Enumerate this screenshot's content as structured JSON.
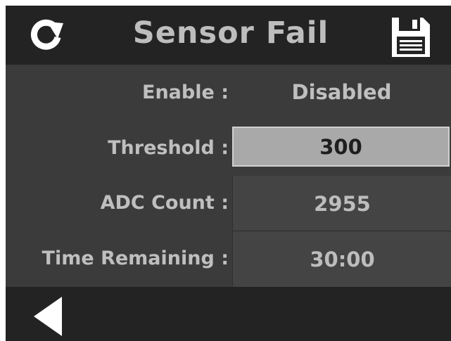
{
  "header": {
    "title": "Sensor Fail",
    "refresh_icon": "refresh-icon",
    "save_icon": "save-icon"
  },
  "rows": {
    "enable": {
      "label": "Enable :",
      "value": "Disabled"
    },
    "threshold": {
      "label": "Threshold :",
      "value": "300"
    },
    "adc_count": {
      "label": "ADC Count :",
      "value": "2955"
    },
    "time_remaining": {
      "label": "Time Remaining :",
      "value": "30:00"
    }
  },
  "footer": {
    "back_icon": "back-arrow-icon"
  },
  "colors": {
    "background": "#3b3b3b",
    "bar": "#232323",
    "text": "#bfbfbf",
    "input_bg": "#a9a9a9"
  }
}
